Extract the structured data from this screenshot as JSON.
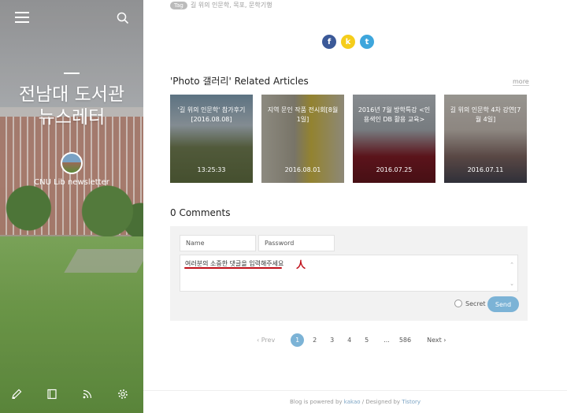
{
  "sidebar": {
    "title_line1": "전남대 도서관",
    "title_line2": "뉴스레터",
    "description": "CNU Lib newsletter"
  },
  "post": {
    "tag_label": "Tag",
    "tags": "길 위의 인문학, 목포, 문학기행"
  },
  "share": {
    "facebook": "f",
    "kakao": "k",
    "twitter": "t",
    "colors": {
      "facebook": "#3b5998",
      "kakao": "#f5cd1b",
      "twitter": "#3ea6dc"
    }
  },
  "related": {
    "title": "'Photo 갤러리' Related Articles",
    "more": "more",
    "articles": [
      {
        "caption": "'길 위의 인문학' 참가후기 [2016.08.08]",
        "date": "13:25:33"
      },
      {
        "caption": "지역 문인 작품 전시회[8월 1일]",
        "date": "2016.08.01"
      },
      {
        "caption": "2016년 7월 방학특강 <인용색인 DB 활용 교육>",
        "date": "2016.07.25"
      },
      {
        "caption": "길 위의 인문학 4차 강연[7월 4일]",
        "date": "2016.07.11"
      }
    ]
  },
  "comments": {
    "title": "0 Comments",
    "name_placeholder": "Name",
    "password_placeholder": "Password",
    "text_placeholder": "여러분의 소중한 댓글을 입력해주세요",
    "secret_label": "Secret",
    "send_label": "Send"
  },
  "pager": {
    "prev": "‹ Prev",
    "pages": [
      "1",
      "2",
      "3",
      "4",
      "5"
    ],
    "ellipsis": "...",
    "last": "586",
    "next": "Next ›"
  },
  "footer": {
    "prefix": "Blog is powered by ",
    "kakao": "kakao",
    "middle": " / Designed by ",
    "tistory": "Tistory"
  }
}
